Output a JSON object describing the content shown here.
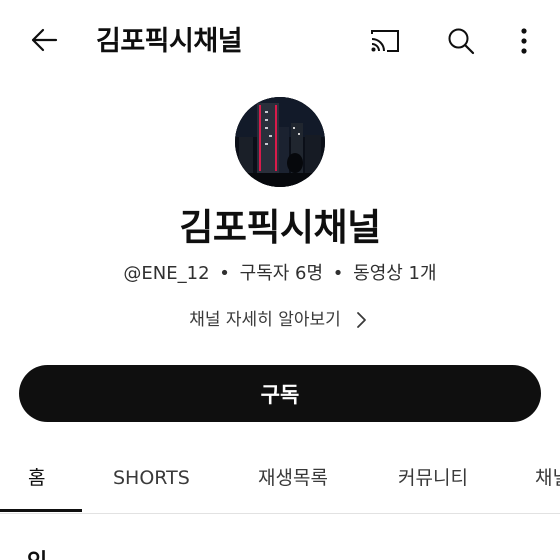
{
  "app_bar": {
    "title": "김포픽시채널",
    "back_icon": "arrow-left-icon",
    "cast_icon": "cast-icon",
    "search_icon": "search-icon",
    "more_icon": "more-vertical-icon"
  },
  "channel": {
    "name": "김포픽시채널",
    "handle": "@ENE_12",
    "subscribers": "구독자 6명",
    "videos": "동영상 1개",
    "separator": "•",
    "about_label": "채널 자세히 알아보기"
  },
  "subscribe": {
    "label": "구독",
    "color": "#0f0f0f"
  },
  "tabs": [
    {
      "label": "홈",
      "active": true
    },
    {
      "label": "SHORTS",
      "active": false
    },
    {
      "label": "재생목록",
      "active": false
    },
    {
      "label": "커뮤니티",
      "active": false
    },
    {
      "label": "채널",
      "active": false
    }
  ],
  "section_peek": "인"
}
